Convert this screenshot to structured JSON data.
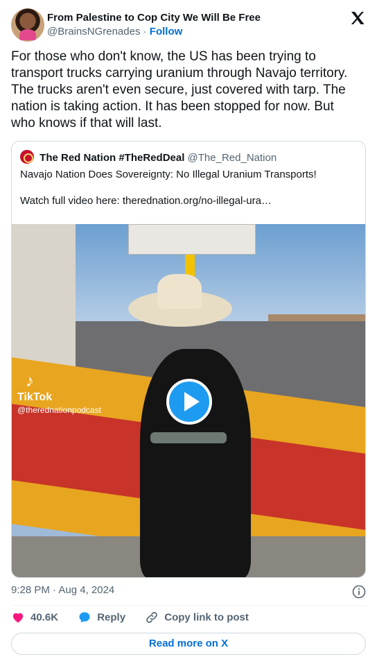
{
  "author": {
    "name": "From Palestine to Cop City We Will Be Free",
    "handle": "@BrainsNGrenades",
    "separator": "·",
    "follow_label": "Follow"
  },
  "tweet_lines": [
    "For those who don't know, the US has been trying to",
    "transport trucks carrying uranium through Navajo territory.",
    "The trucks aren't even secure, just covered with tarp. The",
    "nation is taking action. It has been stopped for now. But",
    "who knows if that will last."
  ],
  "quoted": {
    "name": "The Red Nation #TheRedDeal",
    "handle": "@The_Red_Nation",
    "text": "Navajo Nation Does Sovereignty: No Illegal Uranium Transports!",
    "text2": "Watch full video here: therednation.org/no-illegal-ura…",
    "watermark_logo": "♪",
    "watermark_name": "TikTok",
    "watermark_handle": "@therednationpodcast"
  },
  "timestamp": "9:28 PM · Aug 4, 2024",
  "actions": {
    "likes": "40.6K",
    "reply_label": "Reply",
    "copy_label": "Copy link to post"
  },
  "read_more_label": "Read more on X",
  "colors": {
    "like": "#f91880",
    "reply": "#1d9bf0",
    "link": "#006fd6",
    "secondary": "#536471"
  },
  "icons": {
    "brand": "x-logo-icon",
    "info": "info-icon",
    "like": "heart-icon",
    "reply": "speech-bubble-icon",
    "copy": "link-icon",
    "play": "play-icon"
  }
}
